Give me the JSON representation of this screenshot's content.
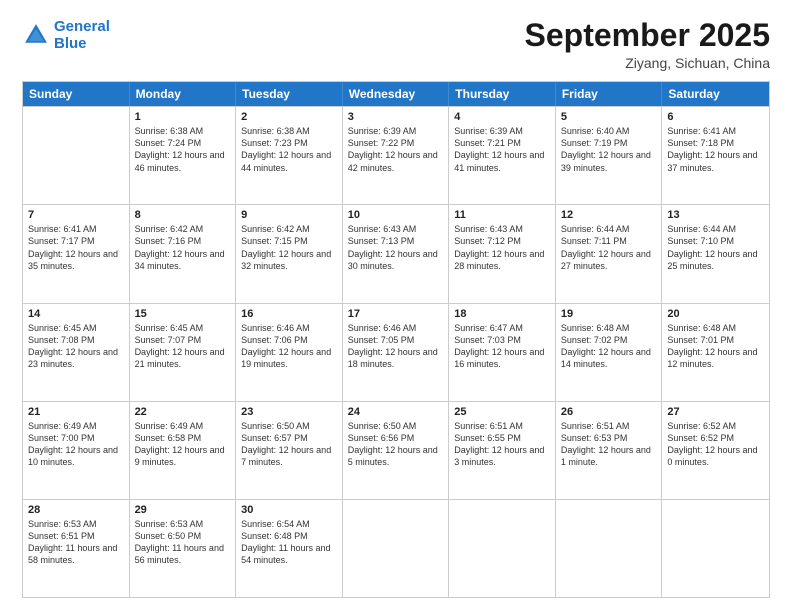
{
  "header": {
    "logo_line1": "General",
    "logo_line2": "Blue",
    "month_title": "September 2025",
    "location": "Ziyang, Sichuan, China"
  },
  "weekdays": [
    "Sunday",
    "Monday",
    "Tuesday",
    "Wednesday",
    "Thursday",
    "Friday",
    "Saturday"
  ],
  "rows": [
    [
      {
        "day": "",
        "sunrise": "",
        "sunset": "",
        "daylight": ""
      },
      {
        "day": "1",
        "sunrise": "Sunrise: 6:38 AM",
        "sunset": "Sunset: 7:24 PM",
        "daylight": "Daylight: 12 hours and 46 minutes."
      },
      {
        "day": "2",
        "sunrise": "Sunrise: 6:38 AM",
        "sunset": "Sunset: 7:23 PM",
        "daylight": "Daylight: 12 hours and 44 minutes."
      },
      {
        "day": "3",
        "sunrise": "Sunrise: 6:39 AM",
        "sunset": "Sunset: 7:22 PM",
        "daylight": "Daylight: 12 hours and 42 minutes."
      },
      {
        "day": "4",
        "sunrise": "Sunrise: 6:39 AM",
        "sunset": "Sunset: 7:21 PM",
        "daylight": "Daylight: 12 hours and 41 minutes."
      },
      {
        "day": "5",
        "sunrise": "Sunrise: 6:40 AM",
        "sunset": "Sunset: 7:19 PM",
        "daylight": "Daylight: 12 hours and 39 minutes."
      },
      {
        "day": "6",
        "sunrise": "Sunrise: 6:41 AM",
        "sunset": "Sunset: 7:18 PM",
        "daylight": "Daylight: 12 hours and 37 minutes."
      }
    ],
    [
      {
        "day": "7",
        "sunrise": "Sunrise: 6:41 AM",
        "sunset": "Sunset: 7:17 PM",
        "daylight": "Daylight: 12 hours and 35 minutes."
      },
      {
        "day": "8",
        "sunrise": "Sunrise: 6:42 AM",
        "sunset": "Sunset: 7:16 PM",
        "daylight": "Daylight: 12 hours and 34 minutes."
      },
      {
        "day": "9",
        "sunrise": "Sunrise: 6:42 AM",
        "sunset": "Sunset: 7:15 PM",
        "daylight": "Daylight: 12 hours and 32 minutes."
      },
      {
        "day": "10",
        "sunrise": "Sunrise: 6:43 AM",
        "sunset": "Sunset: 7:13 PM",
        "daylight": "Daylight: 12 hours and 30 minutes."
      },
      {
        "day": "11",
        "sunrise": "Sunrise: 6:43 AM",
        "sunset": "Sunset: 7:12 PM",
        "daylight": "Daylight: 12 hours and 28 minutes."
      },
      {
        "day": "12",
        "sunrise": "Sunrise: 6:44 AM",
        "sunset": "Sunset: 7:11 PM",
        "daylight": "Daylight: 12 hours and 27 minutes."
      },
      {
        "day": "13",
        "sunrise": "Sunrise: 6:44 AM",
        "sunset": "Sunset: 7:10 PM",
        "daylight": "Daylight: 12 hours and 25 minutes."
      }
    ],
    [
      {
        "day": "14",
        "sunrise": "Sunrise: 6:45 AM",
        "sunset": "Sunset: 7:08 PM",
        "daylight": "Daylight: 12 hours and 23 minutes."
      },
      {
        "day": "15",
        "sunrise": "Sunrise: 6:45 AM",
        "sunset": "Sunset: 7:07 PM",
        "daylight": "Daylight: 12 hours and 21 minutes."
      },
      {
        "day": "16",
        "sunrise": "Sunrise: 6:46 AM",
        "sunset": "Sunset: 7:06 PM",
        "daylight": "Daylight: 12 hours and 19 minutes."
      },
      {
        "day": "17",
        "sunrise": "Sunrise: 6:46 AM",
        "sunset": "Sunset: 7:05 PM",
        "daylight": "Daylight: 12 hours and 18 minutes."
      },
      {
        "day": "18",
        "sunrise": "Sunrise: 6:47 AM",
        "sunset": "Sunset: 7:03 PM",
        "daylight": "Daylight: 12 hours and 16 minutes."
      },
      {
        "day": "19",
        "sunrise": "Sunrise: 6:48 AM",
        "sunset": "Sunset: 7:02 PM",
        "daylight": "Daylight: 12 hours and 14 minutes."
      },
      {
        "day": "20",
        "sunrise": "Sunrise: 6:48 AM",
        "sunset": "Sunset: 7:01 PM",
        "daylight": "Daylight: 12 hours and 12 minutes."
      }
    ],
    [
      {
        "day": "21",
        "sunrise": "Sunrise: 6:49 AM",
        "sunset": "Sunset: 7:00 PM",
        "daylight": "Daylight: 12 hours and 10 minutes."
      },
      {
        "day": "22",
        "sunrise": "Sunrise: 6:49 AM",
        "sunset": "Sunset: 6:58 PM",
        "daylight": "Daylight: 12 hours and 9 minutes."
      },
      {
        "day": "23",
        "sunrise": "Sunrise: 6:50 AM",
        "sunset": "Sunset: 6:57 PM",
        "daylight": "Daylight: 12 hours and 7 minutes."
      },
      {
        "day": "24",
        "sunrise": "Sunrise: 6:50 AM",
        "sunset": "Sunset: 6:56 PM",
        "daylight": "Daylight: 12 hours and 5 minutes."
      },
      {
        "day": "25",
        "sunrise": "Sunrise: 6:51 AM",
        "sunset": "Sunset: 6:55 PM",
        "daylight": "Daylight: 12 hours and 3 minutes."
      },
      {
        "day": "26",
        "sunrise": "Sunrise: 6:51 AM",
        "sunset": "Sunset: 6:53 PM",
        "daylight": "Daylight: 12 hours and 1 minute."
      },
      {
        "day": "27",
        "sunrise": "Sunrise: 6:52 AM",
        "sunset": "Sunset: 6:52 PM",
        "daylight": "Daylight: 12 hours and 0 minutes."
      }
    ],
    [
      {
        "day": "28",
        "sunrise": "Sunrise: 6:53 AM",
        "sunset": "Sunset: 6:51 PM",
        "daylight": "Daylight: 11 hours and 58 minutes."
      },
      {
        "day": "29",
        "sunrise": "Sunrise: 6:53 AM",
        "sunset": "Sunset: 6:50 PM",
        "daylight": "Daylight: 11 hours and 56 minutes."
      },
      {
        "day": "30",
        "sunrise": "Sunrise: 6:54 AM",
        "sunset": "Sunset: 6:48 PM",
        "daylight": "Daylight: 11 hours and 54 minutes."
      },
      {
        "day": "",
        "sunrise": "",
        "sunset": "",
        "daylight": ""
      },
      {
        "day": "",
        "sunrise": "",
        "sunset": "",
        "daylight": ""
      },
      {
        "day": "",
        "sunrise": "",
        "sunset": "",
        "daylight": ""
      },
      {
        "day": "",
        "sunrise": "",
        "sunset": "",
        "daylight": ""
      }
    ]
  ]
}
